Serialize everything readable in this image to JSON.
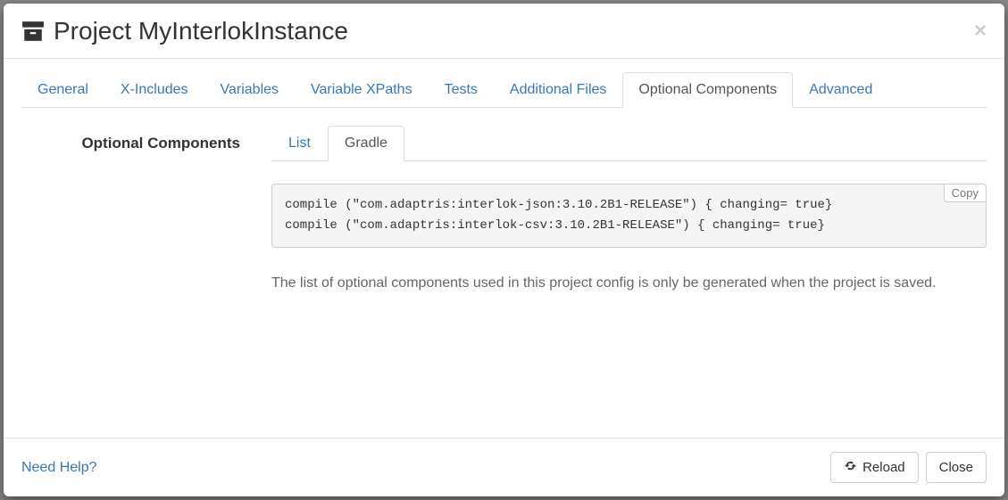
{
  "header": {
    "title": "Project MyInterlokInstance"
  },
  "tabs": {
    "general": "General",
    "xincludes": "X-Includes",
    "variables": "Variables",
    "variable_xpaths": "Variable XPaths",
    "tests": "Tests",
    "additional_files": "Additional Files",
    "optional_components": "Optional Components",
    "advanced": "Advanced"
  },
  "section": {
    "heading": "Optional Components",
    "sub_tabs": {
      "list": "List",
      "gradle": "Gradle"
    },
    "copy_label": "Copy",
    "code": "compile (\"com.adaptris:interlok-json:3.10.2B1-RELEASE\") { changing= true}\ncompile (\"com.adaptris:interlok-csv:3.10.2B1-RELEASE\") { changing= true}",
    "info": "The list of optional components used in this project config is only be generated when the project is saved."
  },
  "footer": {
    "help": "Need Help?",
    "reload": "Reload",
    "close": "Close"
  }
}
